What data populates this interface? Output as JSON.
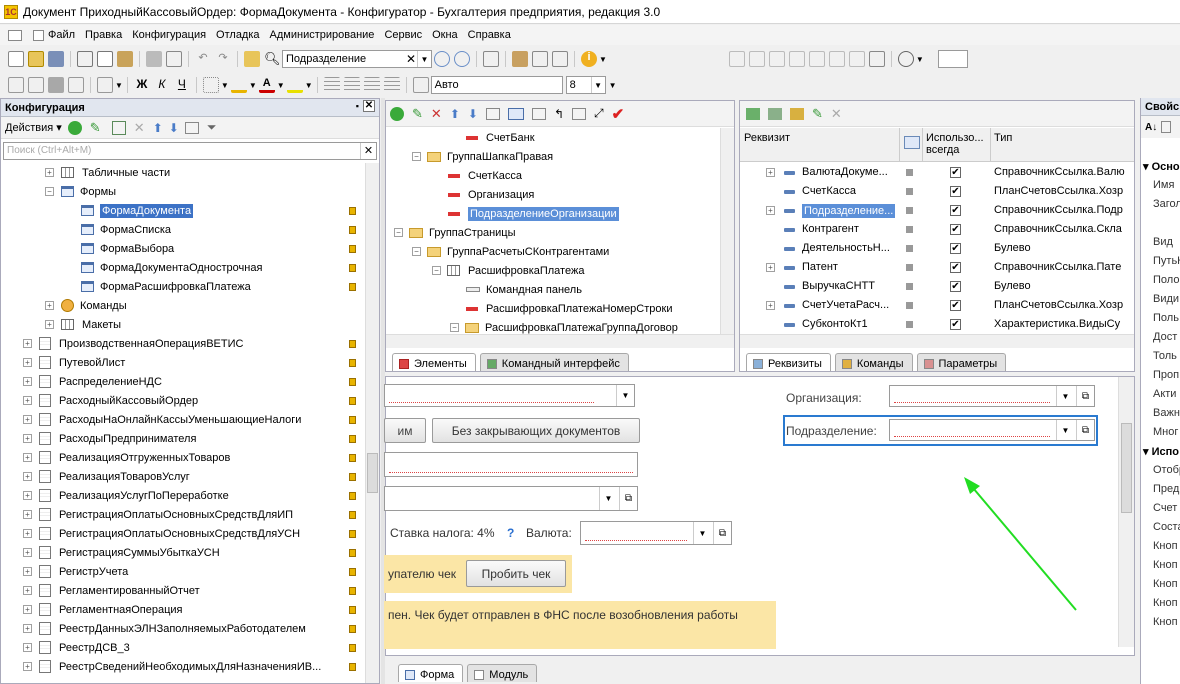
{
  "window": {
    "title": "Документ ПриходныйКассовыйОрдер: ФормаДокумента - Конфигуратор - Бухгалтерия предприятия, редакция 3.0"
  },
  "menu": [
    "Файл",
    "Правка",
    "Конфигурация",
    "Отладка",
    "Администрирование",
    "Сервис",
    "Окна",
    "Справка"
  ],
  "toolbar": {
    "search_value": "Подразделение",
    "font_value": "Авто",
    "size_value": "8"
  },
  "config_panel": {
    "title": "Конфигурация",
    "actions_label": "Действия",
    "search_placeholder": "Поиск (Ctrl+Alt+M)",
    "items": [
      {
        "label": "Табличные части",
        "type": "tab",
        "level": 1
      },
      {
        "label": "Формы",
        "type": "form",
        "level": 1
      },
      {
        "label": "ФормаДокумента",
        "type": "form",
        "level": 2,
        "selected": true
      },
      {
        "label": "ФормаСписка",
        "type": "form",
        "level": 2
      },
      {
        "label": "ФормаВыбора",
        "type": "form",
        "level": 2
      },
      {
        "label": "ФормаДокументаОднострочная",
        "type": "form",
        "level": 2
      },
      {
        "label": "ФормаРасшифровкаПлатежа",
        "type": "form",
        "level": 2
      },
      {
        "label": "Команды",
        "type": "cmd",
        "level": 1
      },
      {
        "label": "Макеты",
        "type": "tab",
        "level": 1
      },
      {
        "label": "ПроизводственнаяОперацияВЕТИС",
        "type": "doc",
        "level": 0
      },
      {
        "label": "ПутевойЛист",
        "type": "doc",
        "level": 0
      },
      {
        "label": "РаспределениеНДС",
        "type": "doc",
        "level": 0
      },
      {
        "label": "РасходныйКассовыйОрдер",
        "type": "doc",
        "level": 0
      },
      {
        "label": "РасходыНаОнлайнКассыУменьшающиеНалоги",
        "type": "doc",
        "level": 0
      },
      {
        "label": "РасходыПредпринимателя",
        "type": "doc",
        "level": 0
      },
      {
        "label": "РеализацияОтгруженныхТоваров",
        "type": "doc",
        "level": 0
      },
      {
        "label": "РеализацияТоваровУслуг",
        "type": "doc",
        "level": 0
      },
      {
        "label": "РеализацияУслугПоПереработке",
        "type": "doc",
        "level": 0
      },
      {
        "label": "РегистрацияОплатыОсновныхСредствДляИП",
        "type": "doc",
        "level": 0
      },
      {
        "label": "РегистрацияОплатыОсновныхСредствДляУСН",
        "type": "doc",
        "level": 0
      },
      {
        "label": "РегистрацияСуммыУбыткаУСН",
        "type": "doc",
        "level": 0
      },
      {
        "label": "РегистрУчета",
        "type": "doc",
        "level": 0
      },
      {
        "label": "РегламентированныйОтчет",
        "type": "doc",
        "level": 0
      },
      {
        "label": "РегламентнаяОперация",
        "type": "doc",
        "level": 0
      },
      {
        "label": "РеестрДанныхЭЛНЗаполняемыхРаботодателем",
        "type": "doc",
        "level": 0
      },
      {
        "label": "РеестрДСВ_3",
        "type": "doc",
        "level": 0
      },
      {
        "label": "РеестрСведенийНеобходимыхДляНазначенияИВ...",
        "type": "doc",
        "level": 0
      }
    ]
  },
  "elements_panel": {
    "items": [
      {
        "label": "СчетБанк",
        "type": "red",
        "level": 3
      },
      {
        "label": "ГруппаШапкаПравая",
        "type": "folder",
        "level": 1
      },
      {
        "label": "СчетКасса",
        "type": "red",
        "level": 2
      },
      {
        "label": "Организация",
        "type": "red",
        "level": 2
      },
      {
        "label": "ПодразделениеОрганизации",
        "type": "red",
        "level": 2,
        "selected": true
      },
      {
        "label": "ГруппаСтраницы",
        "type": "folder",
        "level": 0
      },
      {
        "label": "ГруппаРасчетыСКонтрагентами",
        "type": "folder",
        "level": 1
      },
      {
        "label": "РасшифровкаПлатежа",
        "type": "table",
        "level": 2
      },
      {
        "label": "Командная панель",
        "type": "cmdpanel",
        "level": 3
      },
      {
        "label": "РасшифровкаПлатежаНомерСтроки",
        "type": "red",
        "level": 3
      },
      {
        "label": "РасшифровкаПлатежаГруппаДоговор",
        "type": "folder",
        "level": 3
      }
    ],
    "tabs": [
      "Элементы",
      "Командный интерфейс"
    ]
  },
  "attrs_panel": {
    "headers": [
      "Реквизит",
      "Использо... всегда",
      "Тип"
    ],
    "rows": [
      {
        "name": "ВалютаДокуме...",
        "type": "СправочникСсылка.Валю",
        "expand": true,
        "checked": true
      },
      {
        "name": "СчетКасса",
        "type": "ПланСчетовСсылка.Хозр",
        "expand": false,
        "checked": true
      },
      {
        "name": "Подразделение...",
        "type": "СправочникСсылка.Подр",
        "expand": true,
        "checked": true,
        "selected": true
      },
      {
        "name": "Контрагент",
        "type": "СправочникСсылка.Скла",
        "expand": false,
        "checked": true
      },
      {
        "name": "ДеятельностьН...",
        "type": "Булево",
        "expand": false,
        "checked": true
      },
      {
        "name": "Патент",
        "type": "СправочникСсылка.Пате",
        "expand": true,
        "checked": true
      },
      {
        "name": "ВыручкаСНТТ",
        "type": "Булево",
        "expand": false,
        "checked": true
      },
      {
        "name": "СчетУчетаРасч...",
        "type": "ПланСчетовСсылка.Хозр",
        "expand": true,
        "checked": true
      },
      {
        "name": "СубконтоКт1",
        "type": "Характеристика.ВидыСу",
        "expand": false,
        "checked": true
      }
    ],
    "tabs": [
      "Реквизиты",
      "Команды",
      "Параметры"
    ]
  },
  "form_preview": {
    "btn_partial": "им",
    "btn_no_close": "Без закрывающих документов",
    "org_label": "Организация:",
    "dept_label": "Подразделение:",
    "tax_label": "Ставка налога: 4%",
    "help_q": "?",
    "currency_label": "Валюта:",
    "check_text": "упателю чек",
    "punch_button": "Пробить чек",
    "fns_text": "пен. Чек будет отправлен в ФНС после возобновления работы"
  },
  "bottom_tabs": [
    "Форма",
    "Модуль"
  ],
  "props_panel": {
    "title": "Свойс",
    "groups": [
      {
        "label": "Осно",
        "items": [
          "Имя",
          "Загол",
          "",
          "Вид",
          "ПутьН",
          "Поло",
          "Види",
          "Поль",
          "Дост",
          "Толь",
          "Проп",
          "Акти",
          "Важн",
          "Мног"
        ]
      },
      {
        "label": "Испо",
        "items": [
          "Отобр",
          "Пред",
          "Счет",
          "Соста",
          "Кноп",
          "Кноп",
          "Кноп",
          "Кноп",
          "Кноп"
        ]
      }
    ]
  },
  "colors": {
    "selection": "#3c72c6",
    "arrow": "#22dd22",
    "focus_border": "#2a7ad0"
  }
}
